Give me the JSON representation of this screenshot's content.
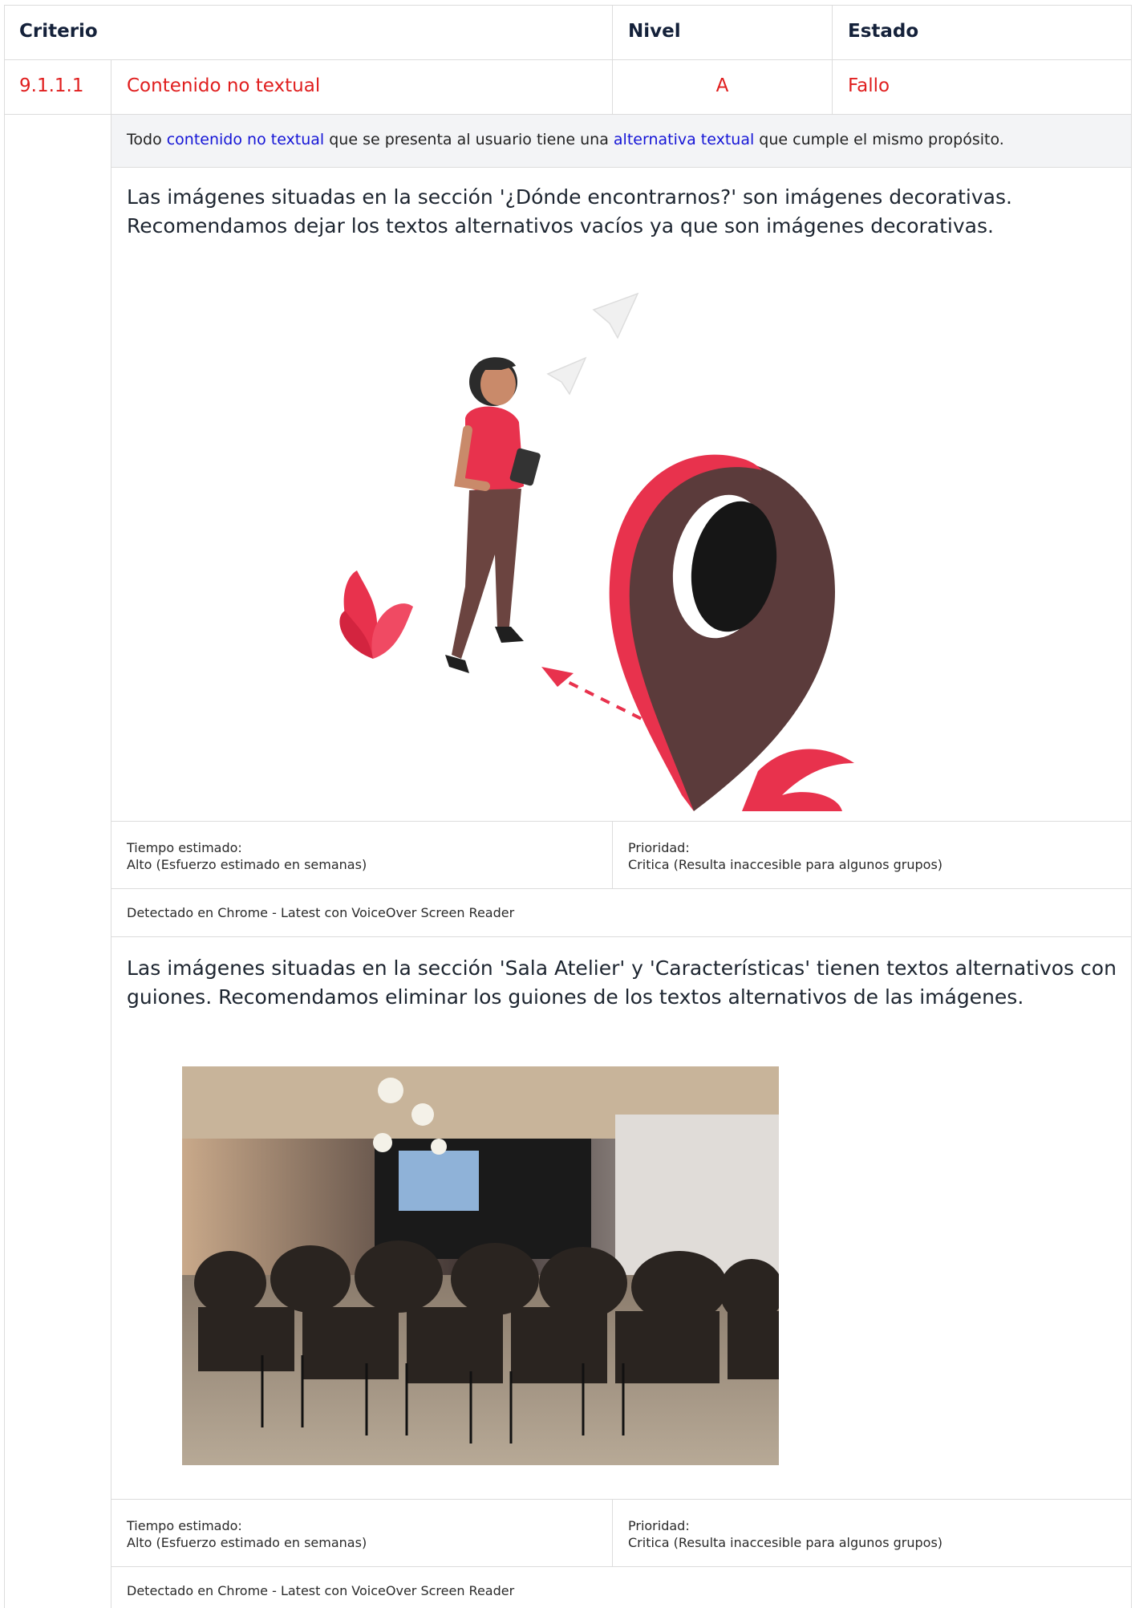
{
  "table": {
    "headers": {
      "criterio": "Criterio",
      "nivel": "Nivel",
      "estado": "Estado"
    },
    "row": {
      "id": "9.1.1.1",
      "name": "Contenido no textual",
      "level": "A",
      "status": "Fallo"
    },
    "description": {
      "part1": "Todo ",
      "link1": "contenido no textual",
      "part2": " que se presenta al usuario tiene una ",
      "link2": "alternativa textual",
      "part3": " que cumple el mismo propósito."
    }
  },
  "findings": [
    {
      "text": "Las imágenes situadas en la sección '¿Dónde encontrarnos?' son imágenes decorativas. Recomendamos dejar los textos alternativos vacíos ya que son imágenes decorativas.",
      "time_label": "Tiempo estimado:",
      "time_value": "Alto (Esfuerzo estimado en semanas)",
      "priority_label": "Prioridad:",
      "priority_value": "Critica (Resulta inaccesible para algunos grupos)",
      "detected": "Detectado en Chrome - Latest con VoiceOver Screen Reader"
    },
    {
      "text": "Las imágenes situadas en la sección 'Sala Atelier' y 'Características' tienen textos alternativos con guiones. Recomendamos eliminar los guiones de los textos alternativos de las imágenes.",
      "time_label": "Tiempo estimado:",
      "time_value": "Alto (Esfuerzo estimado en semanas)",
      "priority_label": "Prioridad:",
      "priority_value": "Critica (Resulta inaccesible para algunos grupos)",
      "detected": "Detectado en Chrome - Latest con VoiceOver Screen Reader"
    }
  ],
  "colors": {
    "fail": "#e01e1e",
    "link": "#1414d6",
    "pin_red": "#e8324d",
    "pin_brown": "#5b3b3b"
  }
}
